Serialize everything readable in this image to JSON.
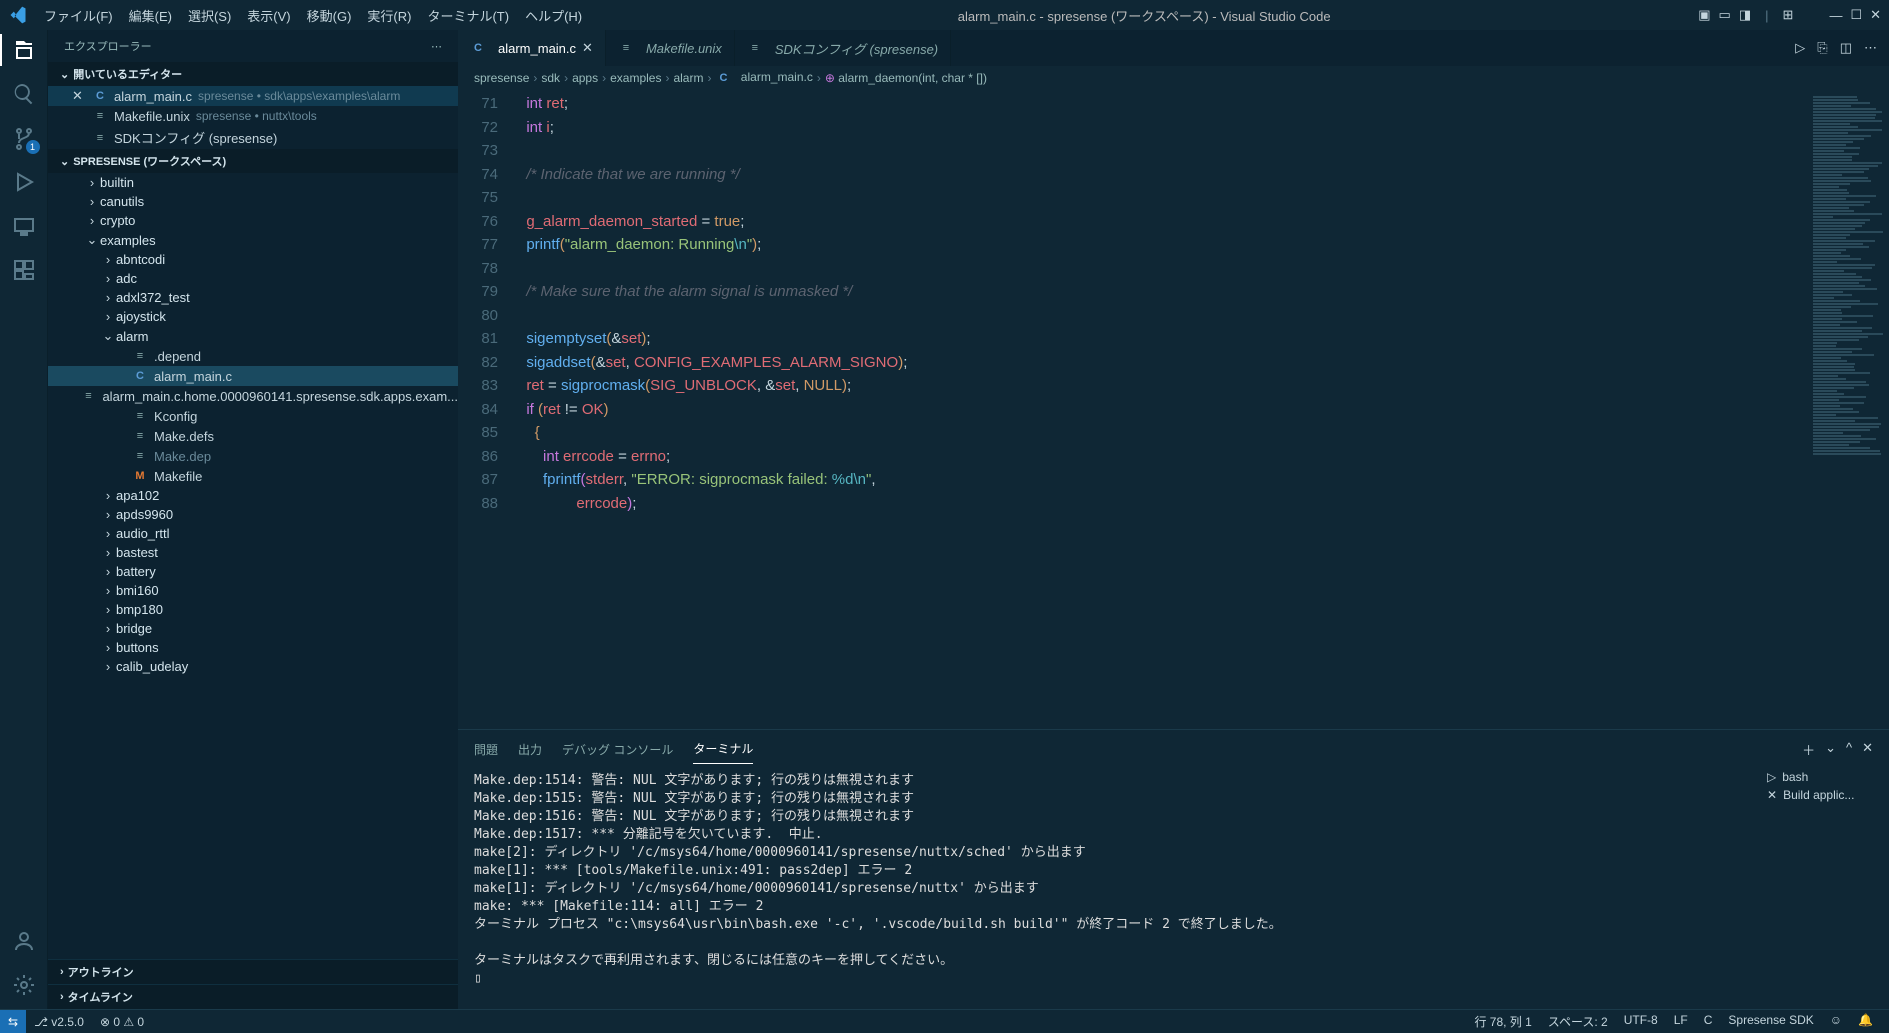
{
  "title": "alarm_main.c - spresense (ワークスペース) - Visual Studio Code",
  "menu": [
    "ファイル(F)",
    "編集(E)",
    "選択(S)",
    "表示(V)",
    "移動(G)",
    "実行(R)",
    "ターミナル(T)",
    "ヘルプ(H)"
  ],
  "sidebar": {
    "title": "エクスプローラー",
    "open_editors_header": "開いているエディター",
    "workspace_header": "SPRESENSE (ワークスペース)",
    "open_editors": [
      {
        "icon": "C",
        "label": "alarm_main.c",
        "hint": "spresense • sdk\\apps\\examples\\alarm",
        "active": true
      },
      {
        "icon": "≡",
        "label": "Makefile.unix",
        "hint": "spresense • nuttx\\tools"
      },
      {
        "icon": "≡",
        "label": "SDKコンフィグ (spresense)",
        "hint": ""
      }
    ],
    "tree": [
      {
        "depth": 1,
        "chev": ">",
        "label": "builtin",
        "type": "folder"
      },
      {
        "depth": 1,
        "chev": ">",
        "label": "canutils",
        "type": "folder"
      },
      {
        "depth": 1,
        "chev": ">",
        "label": "crypto",
        "type": "folder"
      },
      {
        "depth": 1,
        "chev": "v",
        "label": "examples",
        "type": "folder"
      },
      {
        "depth": 2,
        "chev": ">",
        "label": "abntcodi",
        "type": "folder"
      },
      {
        "depth": 2,
        "chev": ">",
        "label": "adc",
        "type": "folder"
      },
      {
        "depth": 2,
        "chev": ">",
        "label": "adxl372_test",
        "type": "folder"
      },
      {
        "depth": 2,
        "chev": ">",
        "label": "ajoystick",
        "type": "folder"
      },
      {
        "depth": 2,
        "chev": "v",
        "label": "alarm",
        "type": "folder"
      },
      {
        "depth": 3,
        "chev": "",
        "label": ".depend",
        "type": "txt"
      },
      {
        "depth": 3,
        "chev": "",
        "label": "alarm_main.c",
        "type": "c",
        "selected": true
      },
      {
        "depth": 3,
        "chev": "",
        "label": "alarm_main.c.home.0000960141.spresense.sdk.apps.exam...",
        "type": "txt"
      },
      {
        "depth": 3,
        "chev": "",
        "label": "Kconfig",
        "type": "txt"
      },
      {
        "depth": 3,
        "chev": "",
        "label": "Make.defs",
        "type": "txt"
      },
      {
        "depth": 3,
        "chev": "",
        "label": "Make.dep",
        "type": "txt",
        "dim": true
      },
      {
        "depth": 3,
        "chev": "",
        "label": "Makefile",
        "type": "m"
      },
      {
        "depth": 2,
        "chev": ">",
        "label": "apa102",
        "type": "folder"
      },
      {
        "depth": 2,
        "chev": ">",
        "label": "apds9960",
        "type": "folder"
      },
      {
        "depth": 2,
        "chev": ">",
        "label": "audio_rttl",
        "type": "folder"
      },
      {
        "depth": 2,
        "chev": ">",
        "label": "bastest",
        "type": "folder"
      },
      {
        "depth": 2,
        "chev": ">",
        "label": "battery",
        "type": "folder"
      },
      {
        "depth": 2,
        "chev": ">",
        "label": "bmi160",
        "type": "folder"
      },
      {
        "depth": 2,
        "chev": ">",
        "label": "bmp180",
        "type": "folder"
      },
      {
        "depth": 2,
        "chev": ">",
        "label": "bridge",
        "type": "folder"
      },
      {
        "depth": 2,
        "chev": ">",
        "label": "buttons",
        "type": "folder"
      },
      {
        "depth": 2,
        "chev": ">",
        "label": "calib_udelay",
        "type": "folder"
      }
    ],
    "outline": "アウトライン",
    "timeline": "タイムライン"
  },
  "tabs": [
    {
      "icon": "C",
      "label": "alarm_main.c",
      "active": true,
      "close": true
    },
    {
      "icon": "≡",
      "label": "Makefile.unix",
      "active": false
    },
    {
      "icon": "≡",
      "label": "SDKコンフィグ (spresense)",
      "active": false
    }
  ],
  "breadcrumb": [
    "spresense",
    "sdk",
    "apps",
    "examples",
    "alarm",
    "alarm_main.c",
    "alarm_daemon(int, char * [])"
  ],
  "breadcrumb_icons": [
    "",
    "",
    "",
    "",
    "",
    "C",
    "fn"
  ],
  "line_numbers": [
    "71",
    "72",
    "73",
    "74",
    "75",
    "76",
    "77",
    "78",
    "79",
    "80",
    "81",
    "82",
    "83",
    "84",
    "85",
    "86",
    "87",
    "88"
  ],
  "panel": {
    "tabs": [
      "問題",
      "出力",
      "デバッグ コンソール",
      "ターミナル"
    ],
    "active": 3,
    "terminal_side": [
      {
        "icon": "▷",
        "label": "bash"
      },
      {
        "icon": "✕",
        "label": "Build applic..."
      }
    ],
    "output": "Make.dep:1514: 警告: NUL 文字があります; 行の残りは無視されます\nMake.dep:1515: 警告: NUL 文字があります; 行の残りは無視されます\nMake.dep:1516: 警告: NUL 文字があります; 行の残りは無視されます\nMake.dep:1517: *** 分離記号を欠いています.  中止.\nmake[2]: ディレクトリ '/c/msys64/home/0000960141/spresense/nuttx/sched' から出ます\nmake[1]: *** [tools/Makefile.unix:491: pass2dep] エラー 2\nmake[1]: ディレクトリ '/c/msys64/home/0000960141/spresense/nuttx' から出ます\nmake: *** [Makefile:114: all] エラー 2\nターミナル プロセス \"c:\\msys64\\usr\\bin\\bash.exe '-c', '.vscode/build.sh build'\" が終了コード 2 で終了しました。\n\nターミナルはタスクで再利用されます、閉じるには任意のキーを押してください。\n▯"
  },
  "status": {
    "remote": "⇆",
    "branch": "v2.5.0",
    "errors": "⊗ 0 ⚠ 0",
    "cursor": "行 78, 列 1",
    "spaces": "スペース: 2",
    "encoding": "UTF-8",
    "eol": "LF",
    "lang": "C",
    "sdk": "Spresense SDK",
    "bell": "🔔"
  },
  "scm_badge": "1"
}
